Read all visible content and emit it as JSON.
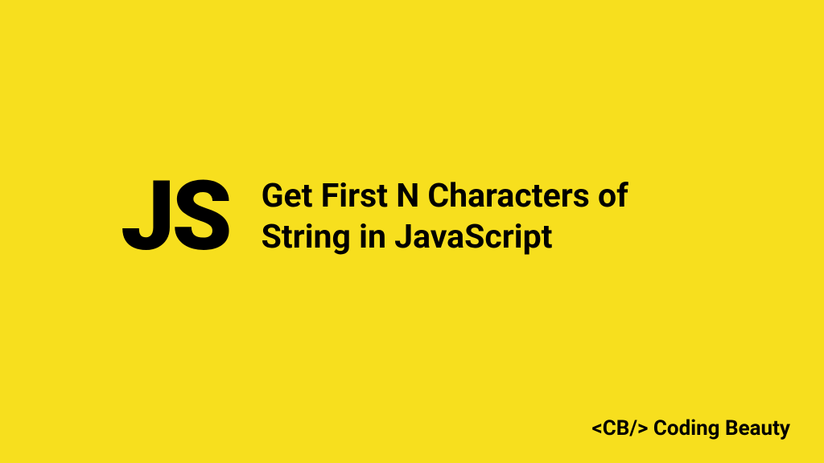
{
  "logo": "JS",
  "title_line1": "Get First N Characters of",
  "title_line2": "String in JavaScript",
  "footer": "<CB/> Coding Beauty"
}
